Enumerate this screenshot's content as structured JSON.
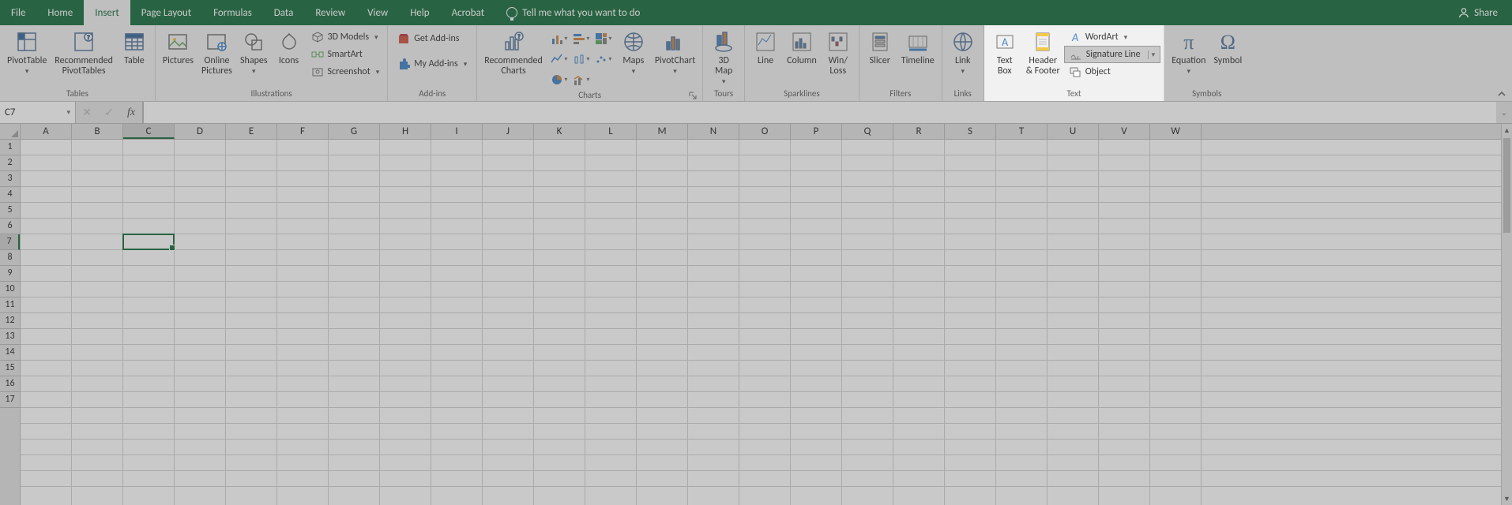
{
  "tabs": {
    "file": "File",
    "home": "Home",
    "insert": "Insert",
    "pagelayout": "Page Layout",
    "formulas": "Formulas",
    "data": "Data",
    "review": "Review",
    "view": "View",
    "help": "Help",
    "acrobat": "Acrobat",
    "tellme": "Tell me what you want to do",
    "share": "Share"
  },
  "ribbon": {
    "tables": {
      "label": "Tables",
      "pivottable": "PivotTable",
      "recpivot": "Recommended\nPivotTables",
      "table": "Table"
    },
    "illustrations": {
      "label": "Illustrations",
      "pictures": "Pictures",
      "onlinepics": "Online\nPictures",
      "shapes": "Shapes",
      "icons": "Icons",
      "models": "3D Models",
      "smartart": "SmartArt",
      "screenshot": "Screenshot"
    },
    "addins": {
      "label": "Add-ins",
      "get": "Get Add-ins",
      "my": "My Add-ins"
    },
    "charts": {
      "label": "Charts",
      "recommended": "Recommended\nCharts",
      "maps": "Maps",
      "pivotchart": "PivotChart"
    },
    "tours": {
      "label": "Tours",
      "map3d": "3D\nMap"
    },
    "sparklines": {
      "label": "Sparklines",
      "line": "Line",
      "column": "Column",
      "winloss": "Win/\nLoss"
    },
    "filters": {
      "label": "Filters",
      "slicer": "Slicer",
      "timeline": "Timeline"
    },
    "links": {
      "label": "Links",
      "link": "Link"
    },
    "text": {
      "label": "Text",
      "textbox": "Text\nBox",
      "header": "Header\n& Footer",
      "wordart": "WordArt",
      "sigline": "Signature Line",
      "object": "Object"
    },
    "symbols": {
      "label": "Symbols",
      "equation": "Equation",
      "symbol": "Symbol"
    }
  },
  "formula_bar": {
    "namebox": "C7",
    "fx": "fx"
  },
  "grid": {
    "columns": [
      "A",
      "B",
      "C",
      "D",
      "E",
      "F",
      "G",
      "H",
      "I",
      "J",
      "K",
      "L",
      "M",
      "N",
      "O",
      "P",
      "Q",
      "R",
      "S",
      "T",
      "U",
      "V",
      "W"
    ],
    "rows": [
      "1",
      "2",
      "3",
      "4",
      "5",
      "6",
      "7",
      "8",
      "9",
      "10",
      "11",
      "12",
      "13",
      "14",
      "15",
      "16",
      "17"
    ],
    "selected_col": "C",
    "selected_row": "7"
  }
}
